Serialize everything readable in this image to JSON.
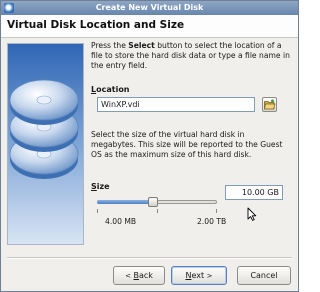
{
  "window": {
    "title": "Create New Virtual Disk"
  },
  "header": {
    "title": "Virtual Disk Location and Size"
  },
  "intro": {
    "part1": "Press the ",
    "bold": "Select",
    "part2": " button to select the location of a file to store the hard disk data or type a file name in the entry field."
  },
  "location": {
    "label_accel": "L",
    "label_rest": "ocation",
    "value": "WinXP.vdi",
    "select_button_icon": "folder-open-icon"
  },
  "size": {
    "description": "Select the size of the virtual hard disk in megabytes. This size will be reported to the Guest OS as the maximum size of this hard disk.",
    "label_accel": "S",
    "label_rest": "ize",
    "value": "10.00 GB",
    "slider_fraction": 0.46,
    "min_label": "4.00 MB",
    "max_label": "2.00 TB"
  },
  "buttons": {
    "back_icon": "<",
    "back_accel": "B",
    "back_rest": "ack",
    "next_accel": "N",
    "next_rest": "ext",
    "next_icon": ">",
    "cancel": "Cancel"
  },
  "colors": {
    "titlebar": "#6886ad",
    "sidebar_top": "#2f66b4",
    "slider_fill": "#4f7fc1"
  }
}
